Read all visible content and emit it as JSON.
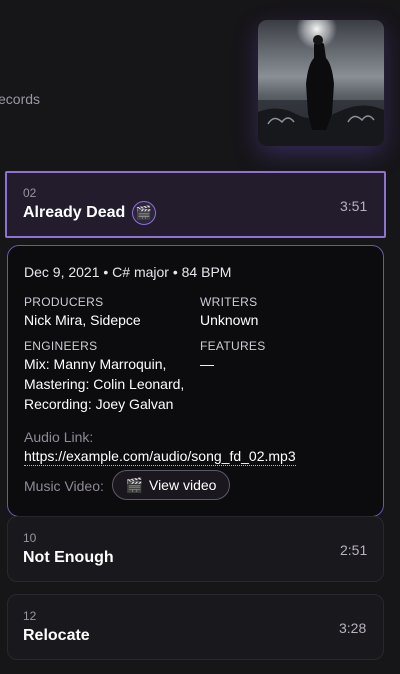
{
  "header": {
    "label_fragment": "ecords"
  },
  "album": {
    "art_alt": "album-cover"
  },
  "active_track": {
    "number": "02",
    "title": "Already Dead",
    "badge_icon": "🎬",
    "duration": "3:51"
  },
  "details": {
    "meta": "Dec 9, 2021 • C# major • 84 BPM",
    "producers_label": "PRODUCERS",
    "producers": "Nick Mira, Sidepce",
    "writers_label": "WRITERS",
    "writers": "Unknown",
    "engineers_label": "ENGINEERS",
    "engineers_1": "Mix: Manny Marroquin,",
    "engineers_2": "Mastering: Colin Leonard,",
    "engineers_3": "Recording: Joey Galvan",
    "features_label": "FEATURES",
    "features": "—",
    "audio_label": "Audio Link:",
    "audio_url": "https://example.com/audio/song_fd_02.mp3",
    "video_label": "Music Video:",
    "video_icon": "🎬",
    "video_button": "View video"
  },
  "tracks": [
    {
      "number": "10",
      "title": "Not Enough",
      "duration": "2:51"
    },
    {
      "number": "12",
      "title": "Relocate",
      "duration": "3:28"
    }
  ],
  "colors": {
    "accent": "#8e72d0",
    "background": "#161518"
  }
}
